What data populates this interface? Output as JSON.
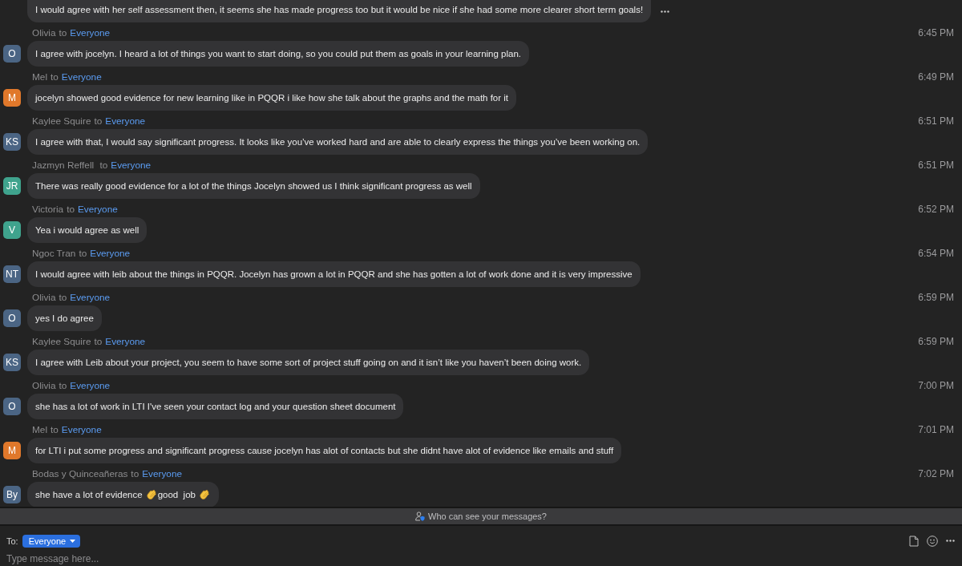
{
  "messages": [
    {
      "text": "I would agree with her self assessment then, it seems she has made progress too but it would be nice if she had some more clearer short term goals!",
      "hovered": true
    },
    {
      "sender": "Olivia",
      "to_word": "to",
      "recipient": "Everyone",
      "time": "6:45 PM",
      "avatar": {
        "initials": "O",
        "color": "#4b6584"
      },
      "text": "I agree with jocelyn. I heard a lot of things you want to start doing, so you could put them as goals in your learning plan.",
      "hovered": false
    },
    {
      "sender": "Mel",
      "to_word": "to",
      "recipient": "Everyone",
      "time": "6:49 PM",
      "avatar": {
        "initials": "M",
        "color": "#e0782b"
      },
      "text": "jocelyn showed good evidence for new learning like in PQQR i like how she talk about the graphs and the math for it",
      "hovered": false
    },
    {
      "sender": "Kaylee Squire",
      "to_word": "to",
      "recipient": "Everyone",
      "time": "6:51 PM",
      "avatar": {
        "initials": "KS",
        "color": "#4b6584"
      },
      "text": "I agree with that, I would say significant progress. It looks like you’ve worked hard and are able to clearly express the things you’ve been working on.",
      "hovered": false
    },
    {
      "sender": "Jazmyn Reffell ",
      "to_word": "to",
      "recipient": "Everyone",
      "time": "6:51 PM",
      "avatar": {
        "initials": "JR",
        "color": "#3fa38d"
      },
      "text": "There was really good evidence for a lot of the things Jocelyn showed us I think significant progress as well",
      "hovered": false
    },
    {
      "sender": "Victoria",
      "to_word": "to",
      "recipient": "Everyone",
      "time": "6:52 PM",
      "avatar": {
        "initials": "V",
        "color": "#3fa38d"
      },
      "text": "Yea i would agree as well",
      "hovered": false
    },
    {
      "sender": "Ngoc Tran",
      "to_word": "to",
      "recipient": "Everyone",
      "time": "6:54 PM",
      "avatar": {
        "initials": "NT",
        "color": "#4b6584"
      },
      "text": "I would agree with leib about the things in PQQR. Jocelyn has grown a lot in PQQR and she has gotten a lot of work done and it is very impressive",
      "hovered": false
    },
    {
      "sender": "Olivia",
      "to_word": "to",
      "recipient": "Everyone",
      "time": "6:59 PM",
      "avatar": {
        "initials": "O",
        "color": "#4b6584"
      },
      "text": "yes I do agree",
      "hovered": false
    },
    {
      "sender": "Kaylee Squire",
      "to_word": "to",
      "recipient": "Everyone",
      "time": "6:59 PM",
      "avatar": {
        "initials": "KS",
        "color": "#4b6584"
      },
      "text": "I agree with Leib about your project, you seem to have some sort of project stuff going on and it isn’t like you haven’t been doing work.",
      "hovered": false
    },
    {
      "sender": "Olivia",
      "to_word": "to",
      "recipient": "Everyone",
      "time": "7:00 PM",
      "avatar": {
        "initials": "O",
        "color": "#4b6584"
      },
      "text": "she has a lot of work in LTI I've seen your contact log and your question sheet document",
      "hovered": false
    },
    {
      "sender": "Mel",
      "to_word": "to",
      "recipient": "Everyone",
      "time": "7:01 PM",
      "avatar": {
        "initials": "M",
        "color": "#e0782b"
      },
      "text": "for LTI i put some progress and significant progress cause jocelyn has alot of contacts but she didnt have alot of evidence like emails and stuff",
      "hovered": false
    },
    {
      "sender": "Bodas y Quinceañeras",
      "to_word": "to",
      "recipient": "Everyone",
      "time": "7:02 PM",
      "avatar": {
        "initials": "By",
        "color": "#4b6584"
      },
      "content": [
        {
          "kind": "text",
          "text": "she have a lot of evidence"
        },
        {
          "kind": "emoji"
        },
        {
          "kind": "text",
          "text": "good  job"
        },
        {
          "kind": "emoji"
        }
      ],
      "hovered": false
    }
  ],
  "visibility_note": "Who can see your messages?",
  "composer": {
    "to_label": "To:",
    "recipient": "Everyone",
    "placeholder": "Type message here..."
  }
}
